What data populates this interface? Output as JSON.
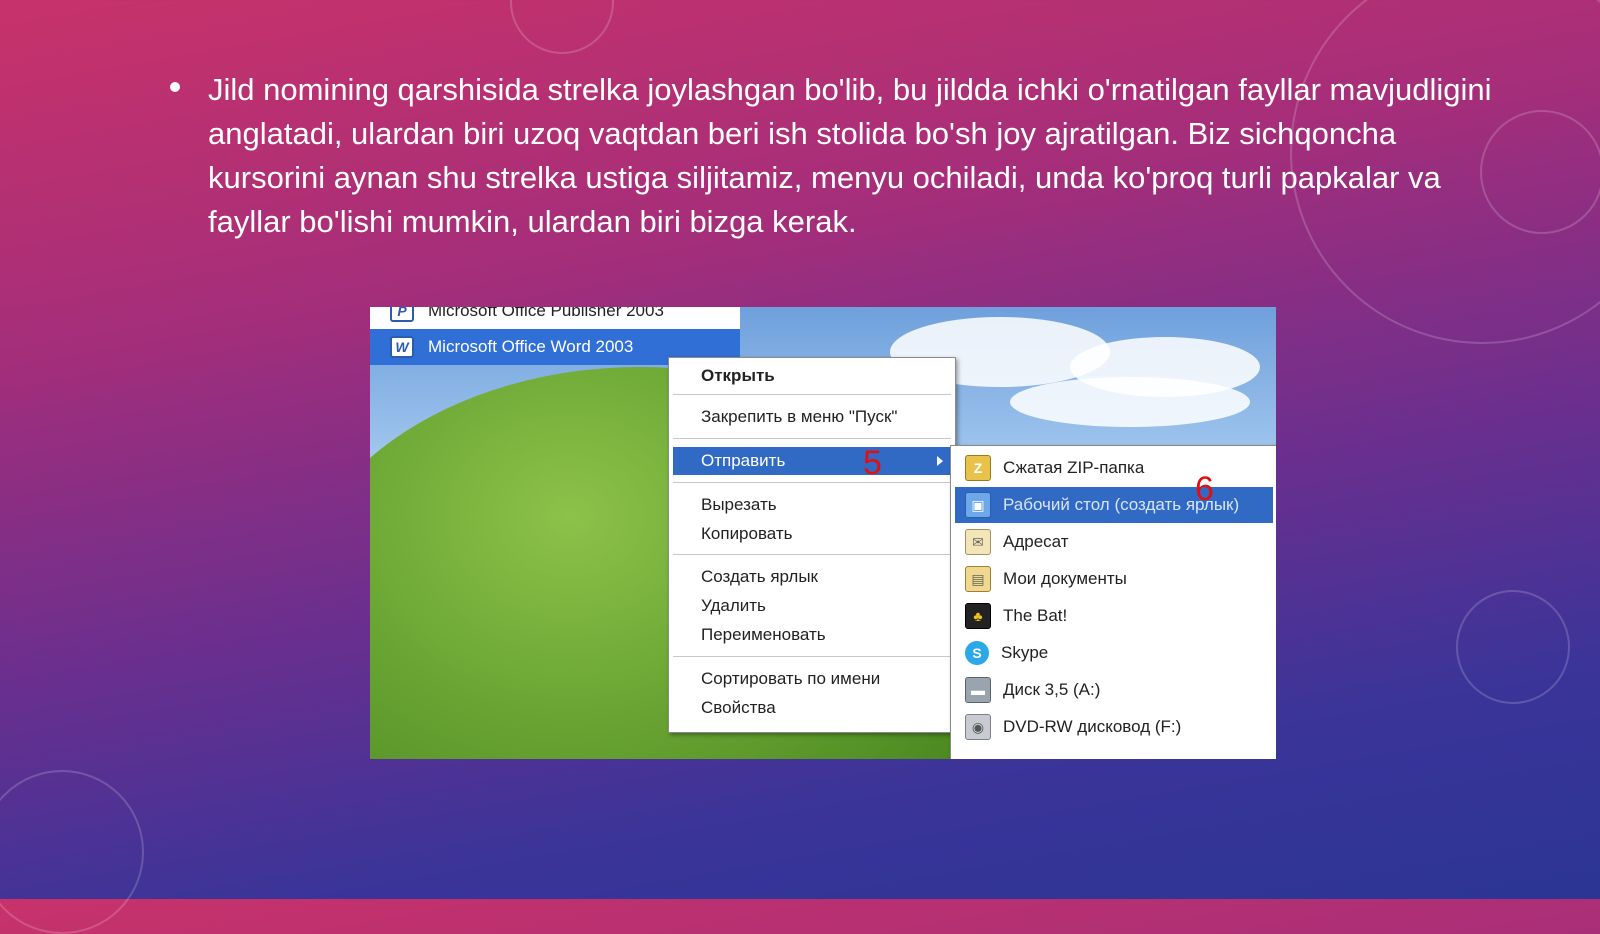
{
  "slide": {
    "bullet_text": "Jild nomining qarshisida strelka joylashgan bo'lib, bu jildda ichki o'rnatilgan fayllar mavjudligini anglatadi, ulardan biri uzoq vaqtdan beri ish stolida bo'sh joy ajratilgan. Biz sichqoncha kursorini aynan shu strelka ustiga siljitamiz, menyu ochiladi, unda ko'proq turli papkalar va fayllar bo'lishi mumkin, ulardan biri bizga kerak."
  },
  "start_menu": {
    "items": [
      {
        "label": "Microsoft Office Publisher 2003",
        "icon": "publisher-icon"
      },
      {
        "label": "Microsoft Office Word 2003",
        "icon": "word-icon",
        "selected": true
      }
    ]
  },
  "context_menu": {
    "items": [
      {
        "label": "Открыть",
        "bold": true
      },
      {
        "label": "Закрепить в меню \"Пуск\""
      },
      {
        "label": "Отправить",
        "highlighted": true,
        "has_submenu": true
      },
      {
        "label": "Вырезать"
      },
      {
        "label": "Копировать"
      },
      {
        "label": "Создать ярлык"
      },
      {
        "label": "Удалить"
      },
      {
        "label": "Переименовать"
      },
      {
        "label": "Сортировать по имени"
      },
      {
        "label": "Свойства"
      }
    ],
    "marker": "5"
  },
  "submenu": {
    "items": [
      {
        "label": "Сжатая ZIP-папка",
        "icon": "zip-folder-icon"
      },
      {
        "label": "Рабочий стол (создать ярлык)",
        "icon": "desktop-icon",
        "highlighted": true
      },
      {
        "label": "Адресат",
        "icon": "mail-recipient-icon"
      },
      {
        "label": "Мои документы",
        "icon": "my-documents-icon"
      },
      {
        "label": "The Bat!",
        "icon": "the-bat-icon"
      },
      {
        "label": "Skype",
        "icon": "skype-icon"
      },
      {
        "label": "Диск 3,5 (A:)",
        "icon": "floppy-drive-icon"
      },
      {
        "label": "DVD-RW дисковод (F:)",
        "icon": "dvd-drive-icon"
      }
    ],
    "marker": "6"
  },
  "colors": {
    "highlight": "#316ac5",
    "marker": "#e01010"
  }
}
